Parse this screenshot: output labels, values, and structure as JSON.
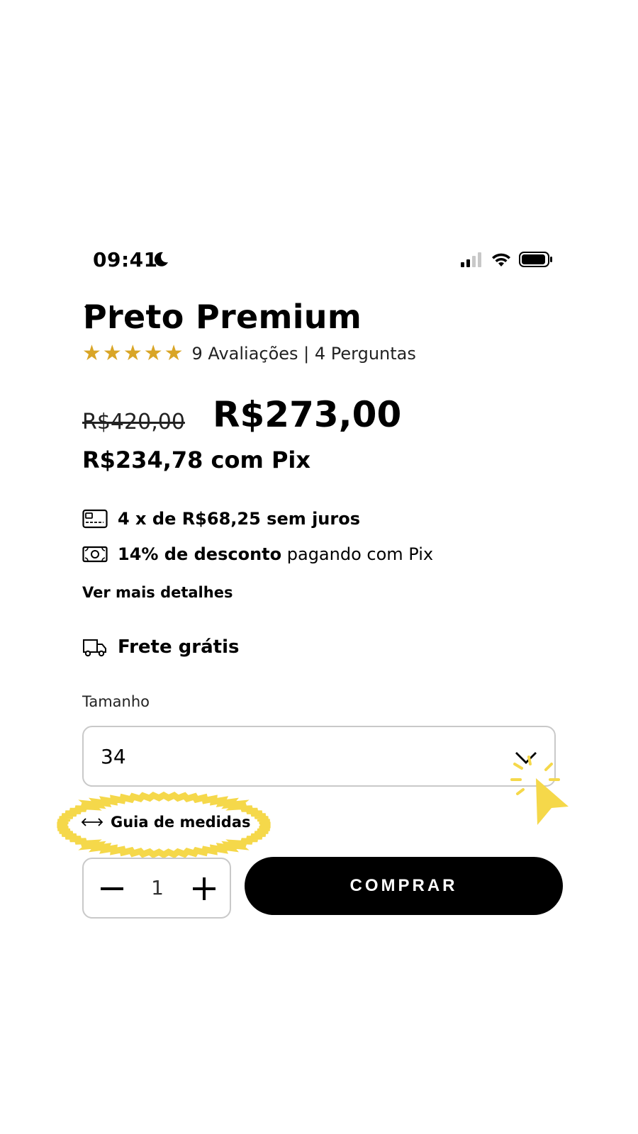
{
  "status_bar": {
    "time": "09:41"
  },
  "product": {
    "title": "Preto Premium",
    "rating": {
      "stars": 5,
      "reviews_text": "9 Avaliações | 4 Perguntas"
    },
    "old_price": "R$420,00",
    "price": "R$273,00",
    "pix_price": "R$234,78 com Pix"
  },
  "payment": {
    "installments": "4 x de R$68,25 sem juros",
    "discount_bold": "14% de desconto",
    "discount_rest": " pagando com Pix",
    "details_link": "Ver mais detalhes"
  },
  "shipping": {
    "label": "Frete grátis"
  },
  "size": {
    "label": "Tamanho",
    "selected": "34",
    "guide_label": "Guia de medidas"
  },
  "quantity": {
    "value": "1"
  },
  "buy_button": {
    "label": "COMPRAR"
  },
  "colors": {
    "accent_yellow": "#f5d84a",
    "star_gold": "#d9a526",
    "button_black": "#000000"
  }
}
